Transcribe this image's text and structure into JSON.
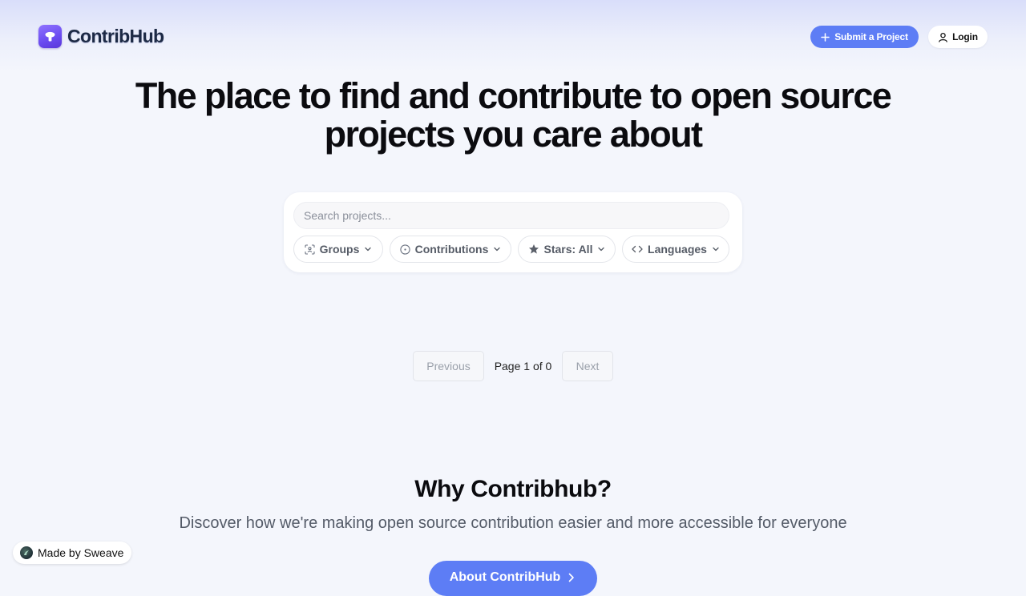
{
  "header": {
    "logo_text": "ContribHub",
    "submit_label": "Submit a Project",
    "login_label": "Login"
  },
  "hero": {
    "title": "The place to find and contribute to open source projects you care about"
  },
  "search": {
    "placeholder": "Search projects..."
  },
  "filters": {
    "groups": "Groups",
    "contributions": "Contributions",
    "stars": "Stars: All",
    "languages": "Languages"
  },
  "pagination": {
    "previous": "Previous",
    "page_label": "Page 1 of 0",
    "next": "Next"
  },
  "why": {
    "title": "Why Contribhub?",
    "subtitle": "Discover how we're making open source contribution easier and more accessible for everyone",
    "about_label": "About ContribHub"
  },
  "badge": {
    "made_by": "Made by Sweave"
  },
  "colors": {
    "accent": "#5d7df5",
    "brand": "#6a4bf0",
    "background": "#f4f6fc"
  },
  "icons": {
    "logo": "cloud-logo-icon",
    "submit": "plus-icon",
    "login": "user-icon",
    "groups": "scan-users-icon",
    "contributions": "info-circle-icon",
    "stars": "star-icon",
    "languages": "code-icon",
    "dropdown": "chevron-down-icon",
    "about": "arrow-right-icon"
  }
}
